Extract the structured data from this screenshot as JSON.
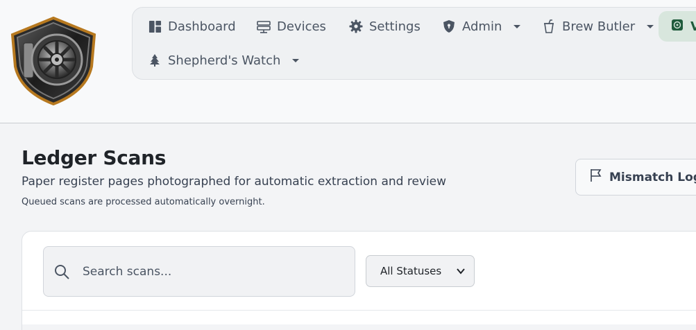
{
  "nav": {
    "items": [
      {
        "label": "Dashboard",
        "icon": "dashboard-icon",
        "dropdown": false
      },
      {
        "label": "Devices",
        "icon": "devices-icon",
        "dropdown": false
      },
      {
        "label": "Settings",
        "icon": "gear-icon",
        "dropdown": false
      },
      {
        "label": "Admin",
        "icon": "shield-icon",
        "dropdown": true
      },
      {
        "label": "Brew Butler",
        "icon": "cup-icon",
        "dropdown": true
      },
      {
        "label": "Shepherd's Watch",
        "icon": "tree-icon",
        "dropdown": true
      }
    ],
    "active_partial": {
      "label": "V",
      "icon": "vault-icon"
    }
  },
  "page": {
    "title": "Ledger Scans",
    "subtitle": "Paper register pages photographed for automatic extraction and review",
    "note": "Queued scans are processed automatically overnight."
  },
  "actions": {
    "mismatch_label": "Mismatch Log"
  },
  "filters": {
    "search_placeholder": "Search scans...",
    "search_value": "",
    "status_selected": "All Statuses"
  },
  "colors": {
    "accent": "#1f5b3c",
    "active_bg": "#d8e6dd",
    "text_muted": "#4b5563"
  }
}
